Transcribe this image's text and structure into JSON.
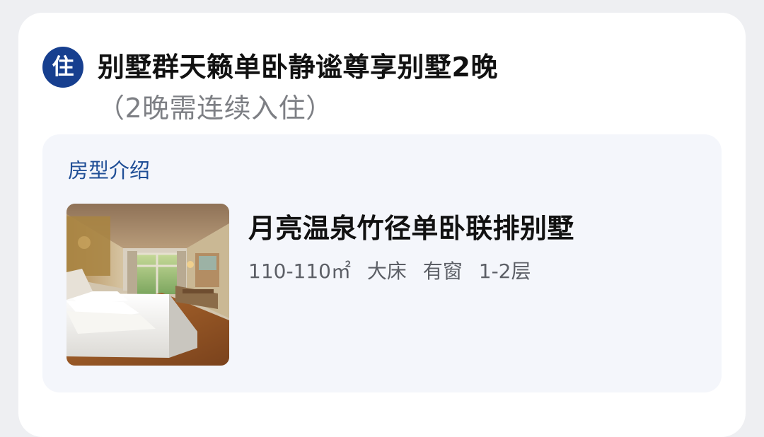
{
  "card": {
    "badge_label": "住",
    "badge_icon": "stay-icon",
    "title": "别墅群天籁单卧静谧尊享别墅2晚",
    "title_note": "（2晚需连续入住）"
  },
  "room_panel": {
    "section_title": "房型介绍",
    "room_name": "月亮温泉竹径单卧联排别墅",
    "specs": {
      "area": "110-110㎡",
      "bed": "大床",
      "window": "有窗",
      "floor": "1-2层"
    },
    "photo_icon": "room-photo"
  },
  "colors": {
    "background": "#eeeff2",
    "card": "#ffffff",
    "accent": "#173f8f",
    "section_title": "#1f4e96",
    "panel": "#f4f6fb",
    "secondary_text": "#7d7f84"
  }
}
